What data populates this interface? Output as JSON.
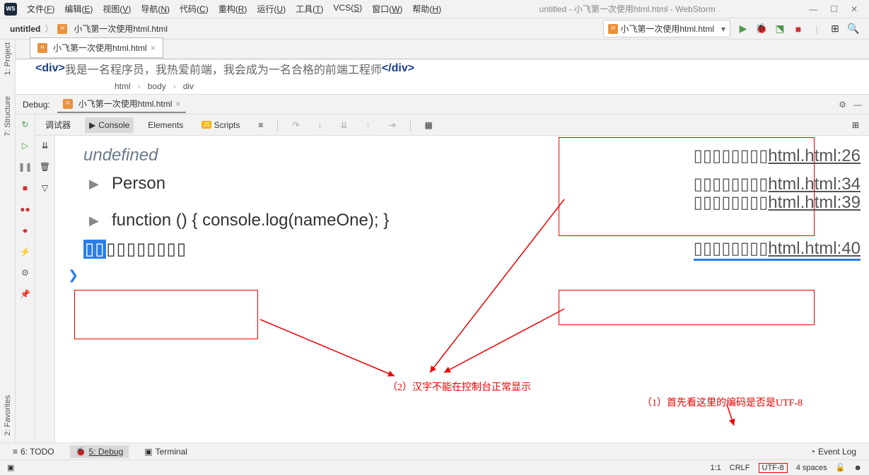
{
  "window": {
    "title": "untitled - 小飞第一次使用html.html - WebStorm"
  },
  "menu": [
    {
      "l": "文件",
      "k": "F"
    },
    {
      "l": "编辑",
      "k": "E"
    },
    {
      "l": "视图",
      "k": "V"
    },
    {
      "l": "导航",
      "k": "N"
    },
    {
      "l": "代码",
      "k": "C"
    },
    {
      "l": "重构",
      "k": "R"
    },
    {
      "l": "运行",
      "k": "U"
    },
    {
      "l": "工具",
      "k": "T"
    },
    {
      "l": "VCS",
      "k": "S"
    },
    {
      "l": "窗口",
      "k": "W"
    },
    {
      "l": "帮助",
      "k": "H"
    }
  ],
  "breadcrumb": {
    "project": "untitled",
    "file": "小飞第一次使用html.html"
  },
  "run_config": "小飞第一次使用html.html",
  "code_snippet": {
    "open": "<div>",
    "text": "我是一名程序员，我热爱前端，我会成为一名合格的前端工程师",
    "close": "</div>"
  },
  "crumbs": [
    "html",
    "body",
    "div"
  ],
  "debug": {
    "label": "Debug:",
    "tab": "小飞第一次使用html.html"
  },
  "tabs": {
    "debugger": "调试器",
    "console": "Console",
    "elements": "Elements",
    "scripts": "Scripts"
  },
  "console": {
    "line1": {
      "left": "undefined",
      "right": "▯▯▯▯▯▯▯▯html.html:26"
    },
    "line2": {
      "left": "Person",
      "right": "▯▯▯▯▯▯▯▯html.html:34"
    },
    "line3": {
      "right": "▯▯▯▯▯▯▯▯html.html:39"
    },
    "line4": {
      "left": "function () { console.log(nameOne); }"
    },
    "line5": {
      "sel": "▯▯",
      "rest": "▯▯▯▯▯▯▯▯",
      "right": "▯▯▯▯▯▯▯▯html.html:40"
    }
  },
  "annotations": {
    "note1": "（1）首先看这里的编码是否是UTF-8",
    "note2": "（2）汉字不能在控制台正常显示"
  },
  "bottom": {
    "todo": "6: TODO",
    "debug": "5: Debug",
    "terminal": "Terminal",
    "eventlog": "Event Log"
  },
  "status": {
    "pos": "1:1",
    "eol": "CRLF",
    "enc": "UTF-8",
    "indent": "4 spaces"
  },
  "rails": {
    "project": "1: Project",
    "structure": "7: Structure",
    "favorites": "2: Favorites"
  }
}
